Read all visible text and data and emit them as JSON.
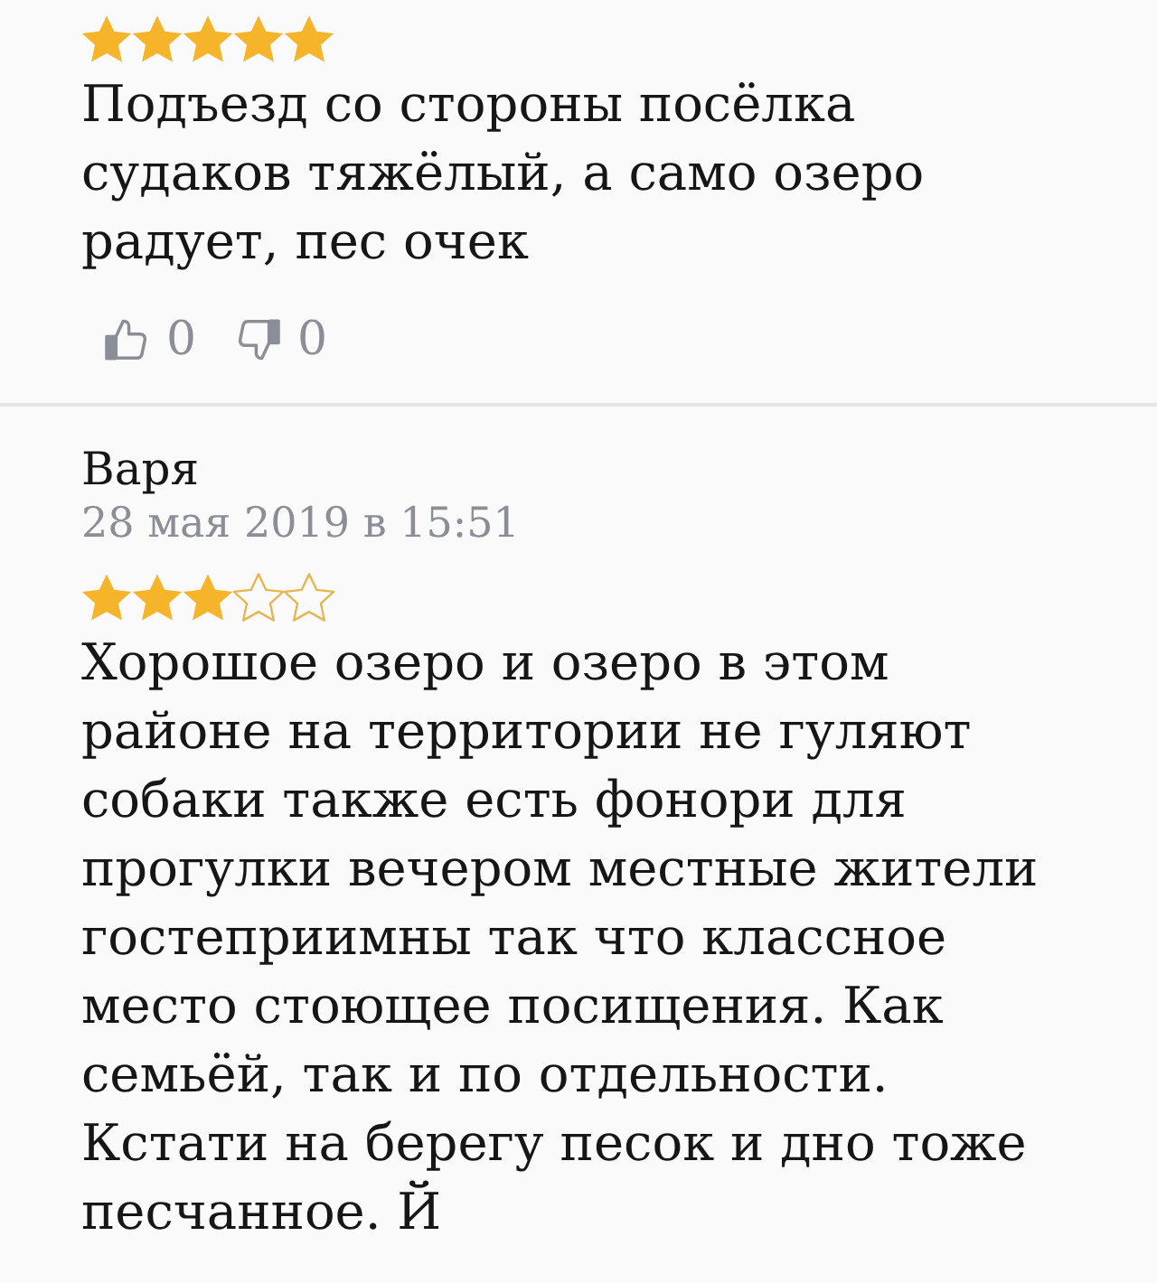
{
  "reviews": [
    {
      "stars": 5,
      "text": "Подъезд со стороны посёлка судаков тяжёлый, а само озеро радует, пес очек",
      "likes": "0",
      "dislikes": "0"
    },
    {
      "author": "Варя",
      "date": "28 мая 2019 в 15:51",
      "stars": 3,
      "text": "Хорошое озеро и озеро в этом районе на территории не гуляют собаки также есть фонори для прогулки вечером местные жители гостеприимны так что классное место стоющее посищения. Как семьёй, так и по отдельности. Кстати на берегу песок и дно тоже песчанное. Й"
    }
  ]
}
